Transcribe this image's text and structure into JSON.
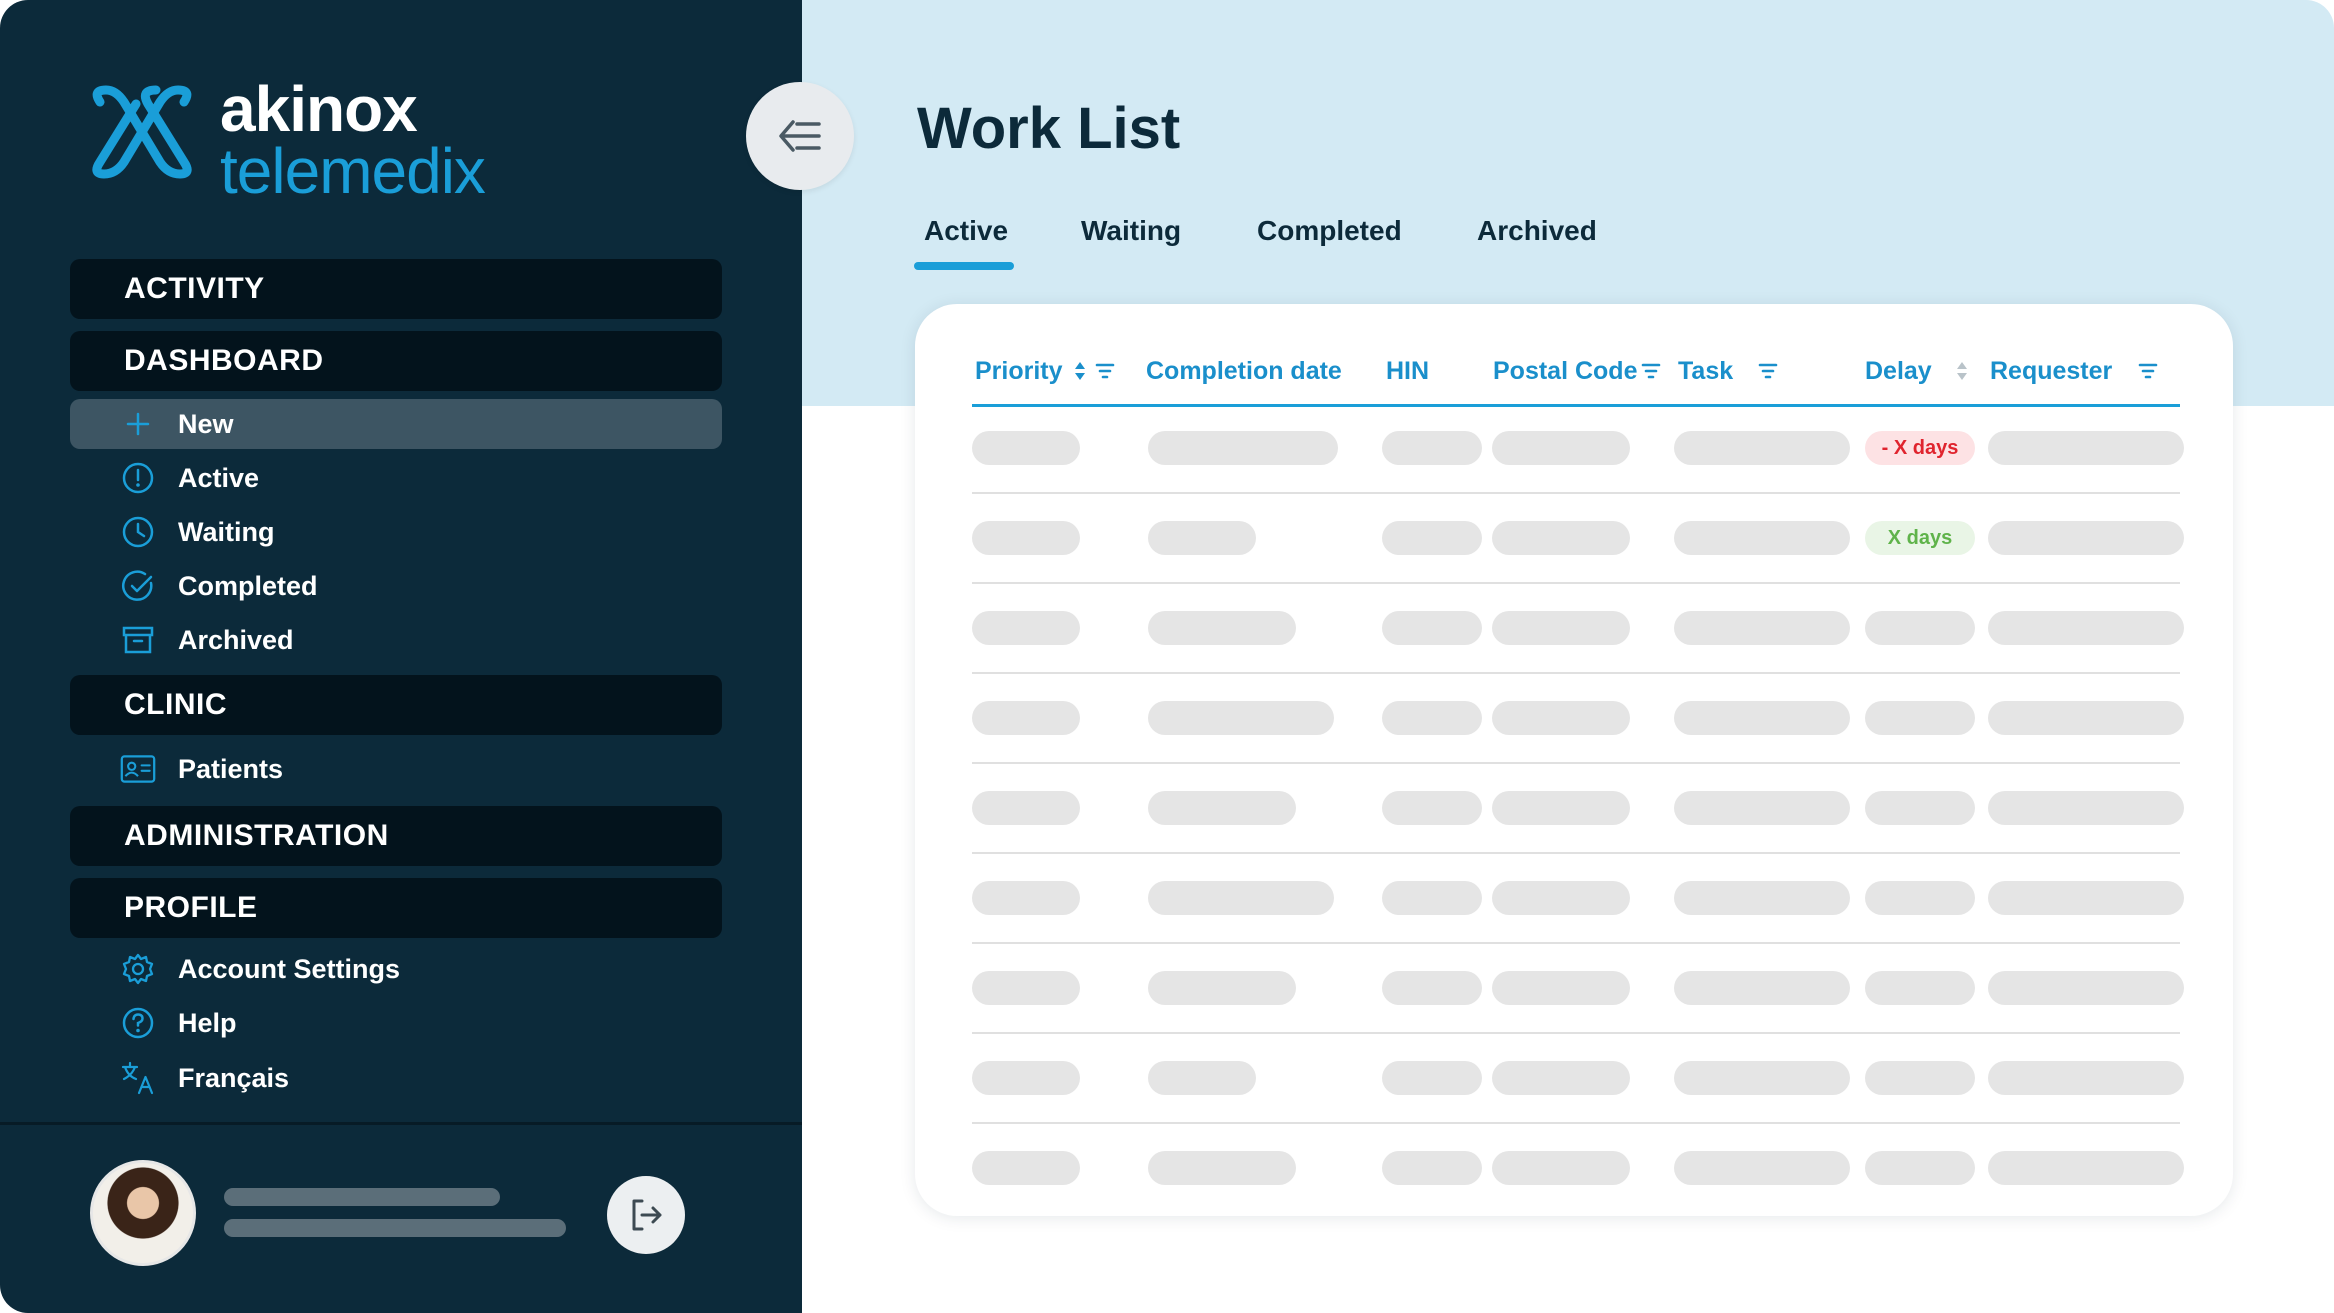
{
  "brand": {
    "name_line1": "akinox",
    "name_line2": "telemedix"
  },
  "sidebar": {
    "sections": {
      "activity": "ACTIVITY",
      "dashboard": "DASHBOARD",
      "clinic": "CLINIC",
      "administration": "ADMINISTRATION",
      "profile": "PROFILE"
    },
    "dashboard_items": [
      "New",
      "Active",
      "Waiting",
      "Completed",
      "Archived"
    ],
    "clinic_items": [
      "Patients"
    ],
    "profile_items": [
      "Account Settings",
      "Help",
      "Français"
    ]
  },
  "page": {
    "title": "Work List",
    "tabs": [
      "Active",
      "Waiting",
      "Completed",
      "Archived"
    ],
    "active_tab": "Active"
  },
  "table": {
    "columns": [
      "Priority",
      "Completion date",
      "HIN",
      "Postal Code",
      "Task",
      "Delay",
      "Requester"
    ],
    "delay_badges": [
      "- X days",
      "X days"
    ]
  },
  "colors": {
    "sidebar_bg": "#0c2a3a",
    "accent": "#1a9ed8",
    "main_header_bg": "#d3eaf4",
    "overdue": "#e0242e",
    "on_time": "#5fb34a"
  }
}
